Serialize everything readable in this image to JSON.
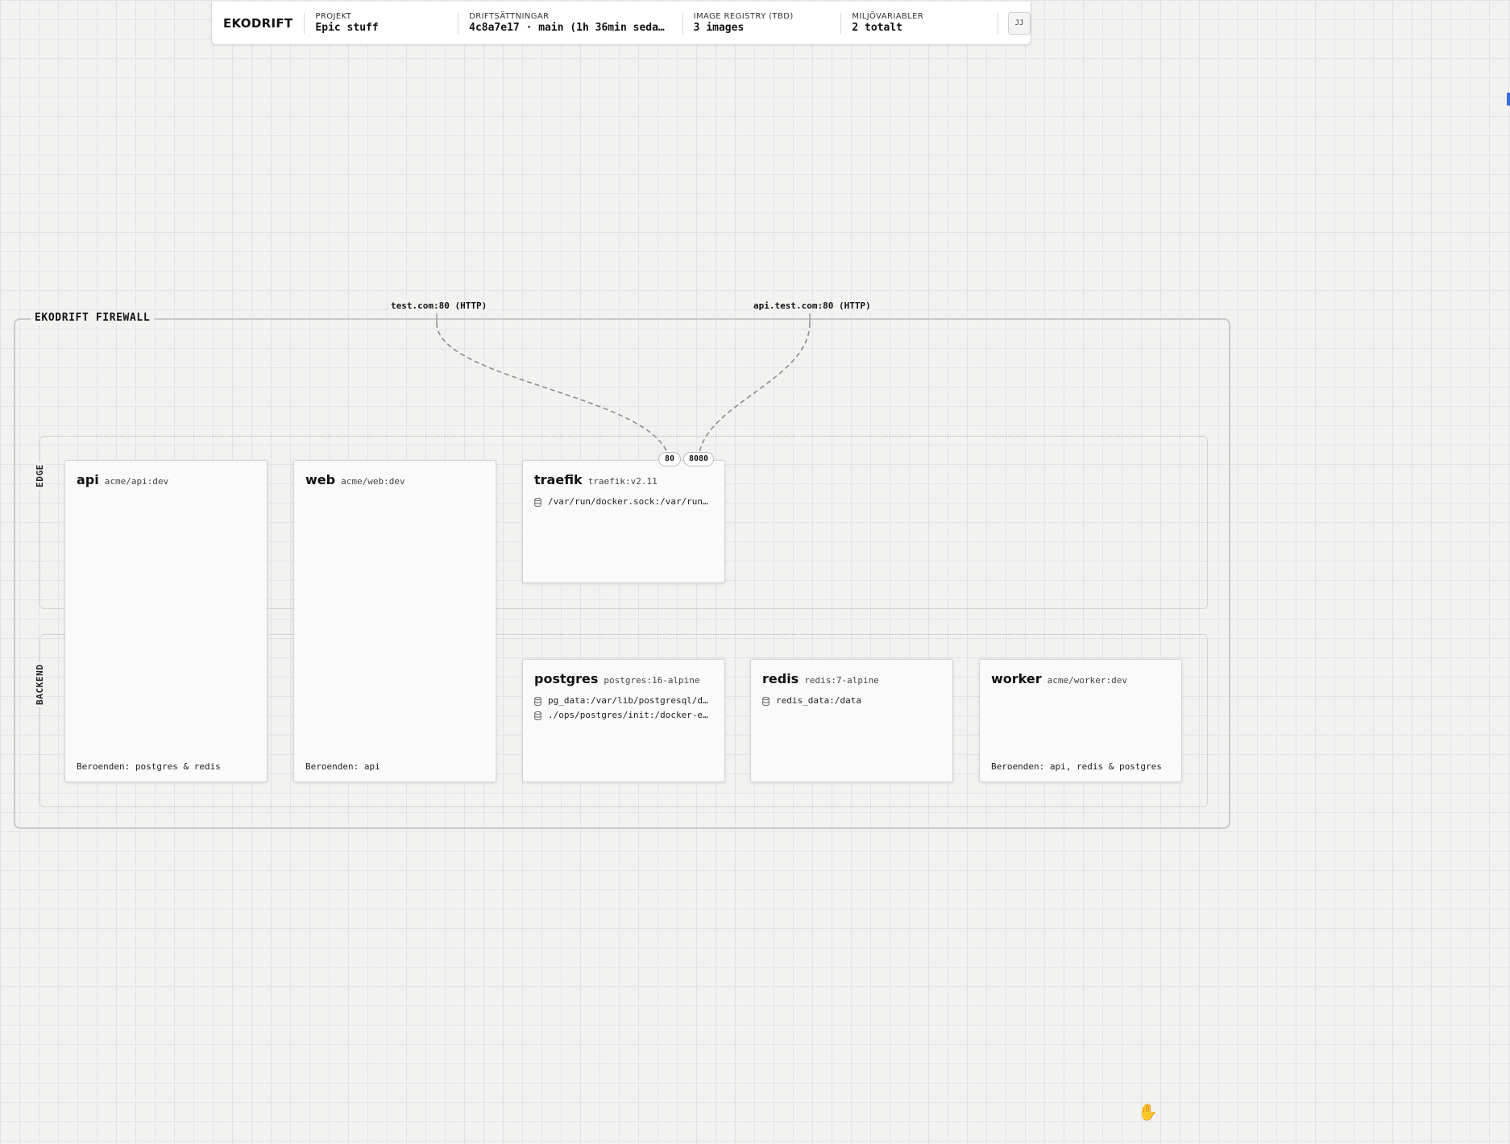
{
  "topbar": {
    "brand": "EKODRIFT",
    "project": {
      "label": "PROJEKT",
      "value": "Epic stuff"
    },
    "deployments": {
      "label": "DRIFTSÄTTNINGAR",
      "value": "4c8a7e17 · main (1h 36min seda…"
    },
    "registry": {
      "label": "IMAGE REGISTRY (TBD)",
      "value": "3 images"
    },
    "env": {
      "label": "MILJÖVARIABLER",
      "value": "2 totalt"
    },
    "avatar": "JJ"
  },
  "firewall": {
    "title": "EKODRIFT FIREWALL",
    "routes": [
      "test.com:80 (HTTP)",
      "api.test.com:80 (HTTP)"
    ]
  },
  "zones": {
    "edge": "EDGE",
    "backend": "BACKEND"
  },
  "services": {
    "api": {
      "name": "api",
      "image": "acme/api:dev",
      "deps": "Beroenden: postgres & redis"
    },
    "web": {
      "name": "web",
      "image": "acme/web:dev",
      "deps": "Beroenden: api"
    },
    "traefik": {
      "name": "traefik",
      "image": "traefik:v2.11",
      "volumes": [
        "/var/run/docker.sock:/var/run…"
      ],
      "ports": [
        "80",
        "8080"
      ]
    },
    "postgres": {
      "name": "postgres",
      "image": "postgres:16-alpine",
      "volumes": [
        "pg_data:/var/lib/postgresql/d…",
        "./ops/postgres/init:/docker-e…"
      ]
    },
    "redis": {
      "name": "redis",
      "image": "redis:7-alpine",
      "volumes": [
        "redis_data:/data"
      ]
    },
    "worker": {
      "name": "worker",
      "image": "acme/worker:dev",
      "deps": "Beroenden: api, redis & postgres"
    }
  },
  "icons": {
    "volume": "database-icon",
    "cursor": "hand-cursor-icon"
  }
}
